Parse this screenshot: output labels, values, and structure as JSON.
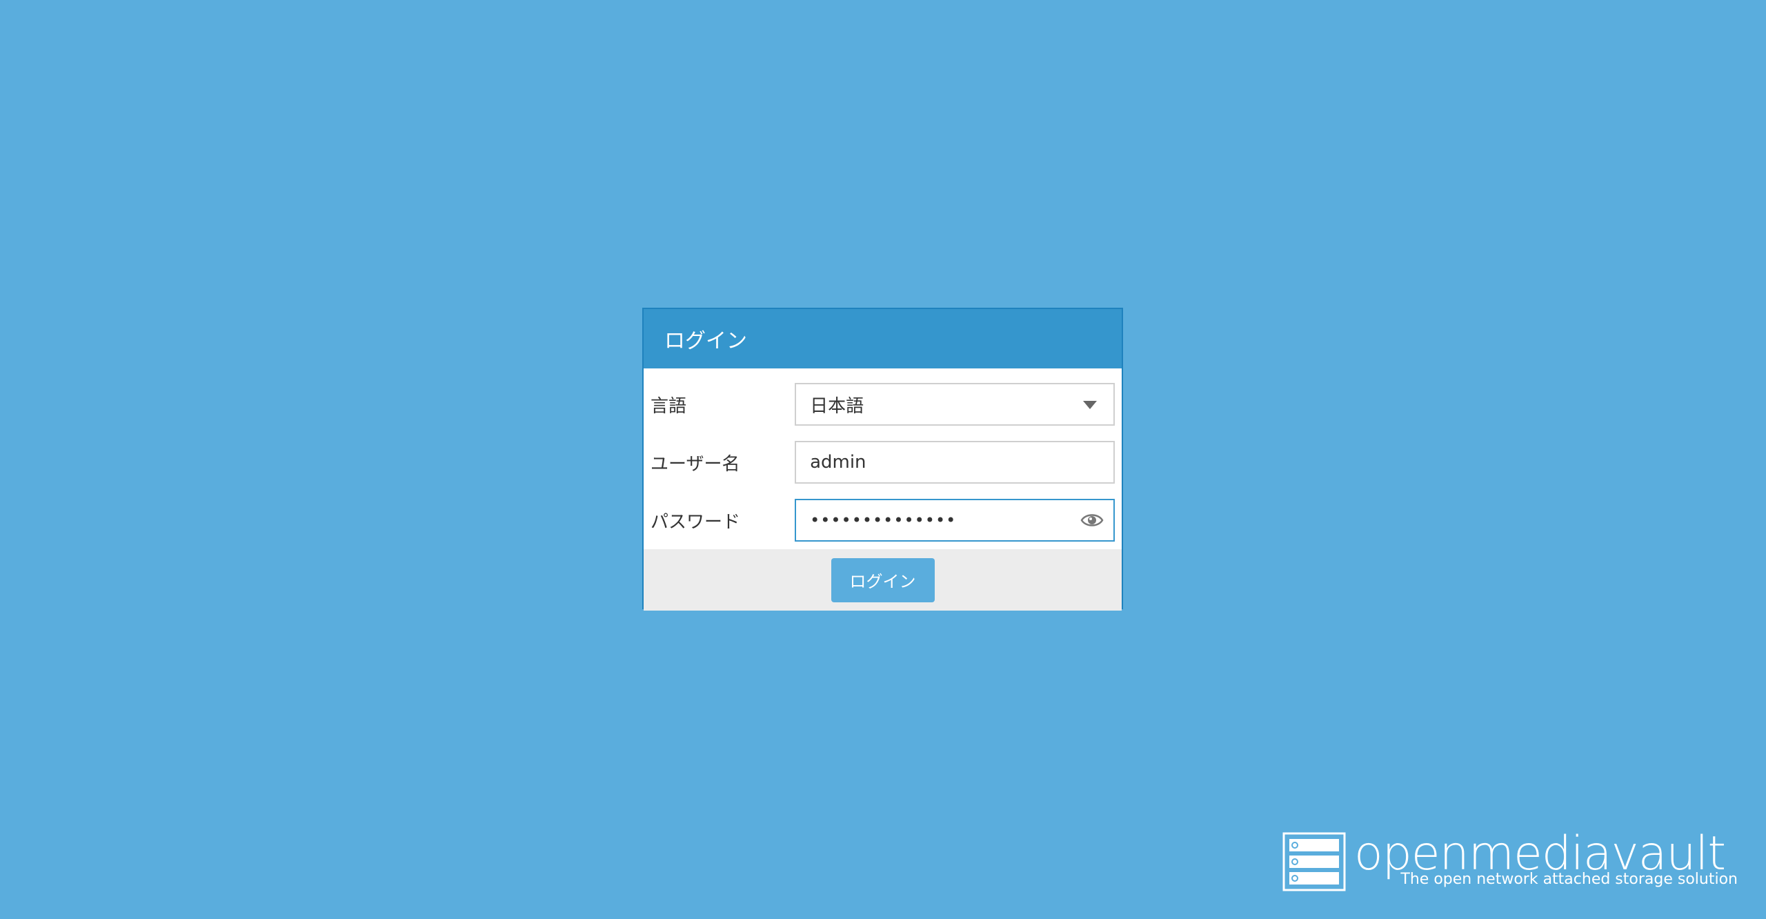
{
  "dialog": {
    "title": "ログイン",
    "language": {
      "label": "言語",
      "selected": "日本語"
    },
    "username": {
      "label": "ユーザー名",
      "value": "admin"
    },
    "password": {
      "label": "パスワード",
      "value": "••••••••••••••"
    },
    "login_button": "ログイン"
  },
  "brand": {
    "name": "openmediavault",
    "tagline": "The open network attached storage solution"
  },
  "icons": {
    "language_dropdown": "chevron-down-icon",
    "password_toggle": "eye-icon",
    "brand_logo": "server-rack-icon"
  },
  "colors": {
    "background": "#5aaddd",
    "header": "#3596cd",
    "border": "#1f82bd",
    "footer": "#ececec"
  }
}
